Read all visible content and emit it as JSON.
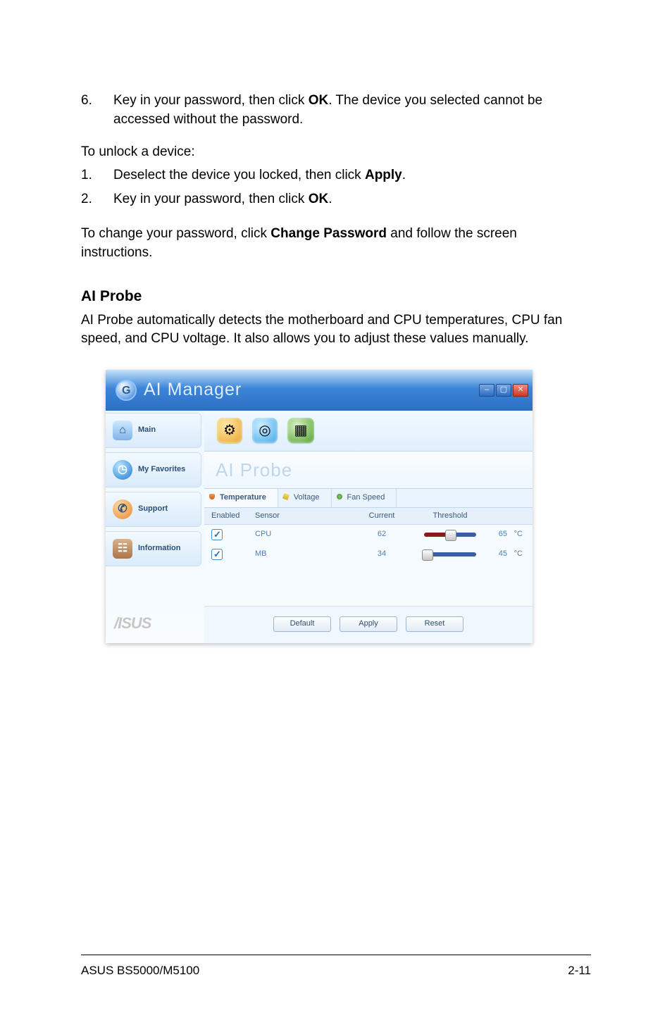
{
  "doc": {
    "step6_num": "6.",
    "step6_txt_a": "Key in your password, then click ",
    "step6_bold": "OK",
    "step6_txt_b": ". The device you selected cannot be accessed without the password.",
    "unlock_intro": "To unlock a device:",
    "u1_num": "1.",
    "u1_a": "Deselect the device you locked, then click ",
    "u1_bold": "Apply",
    "u1_b": ".",
    "u2_num": "2.",
    "u2_a": "Key in your password, then click ",
    "u2_bold": "OK",
    "u2_b": ".",
    "change_a": "To change your password, click ",
    "change_bold": "Change Password",
    "change_b": " and follow the screen instructions.",
    "section_title": "AI Probe",
    "section_desc": "AI Probe automatically detects the motherboard and CPU temperatures, CPU fan speed, and CPU voltage. It also allows you to adjust these values manually."
  },
  "shot": {
    "window_title": "AI Manager",
    "sidebar": {
      "items": [
        "Main",
        "My Favorites",
        "Support",
        "Information"
      ]
    },
    "brand": "/ISUS",
    "panel_title": "AI Probe",
    "tabs": {
      "temperature": "Temperature",
      "voltage": "Voltage",
      "fan": "Fan Speed"
    },
    "headers": {
      "enabled": "Enabled",
      "sensor": "Sensor",
      "current": "Current",
      "threshold": "Threshold"
    },
    "rows": [
      {
        "sensor": "CPU",
        "current": "62",
        "threshold": "65",
        "unit": "°C",
        "slider_pct": "50%"
      },
      {
        "sensor": "MB",
        "current": "34",
        "threshold": "45",
        "unit": "°C",
        "slider_pct": "6%"
      }
    ],
    "buttons": {
      "default": "Default",
      "apply": "Apply",
      "reset": "Reset"
    }
  },
  "footer": {
    "left": "ASUS BS5000/M5100",
    "right": "2-11"
  }
}
